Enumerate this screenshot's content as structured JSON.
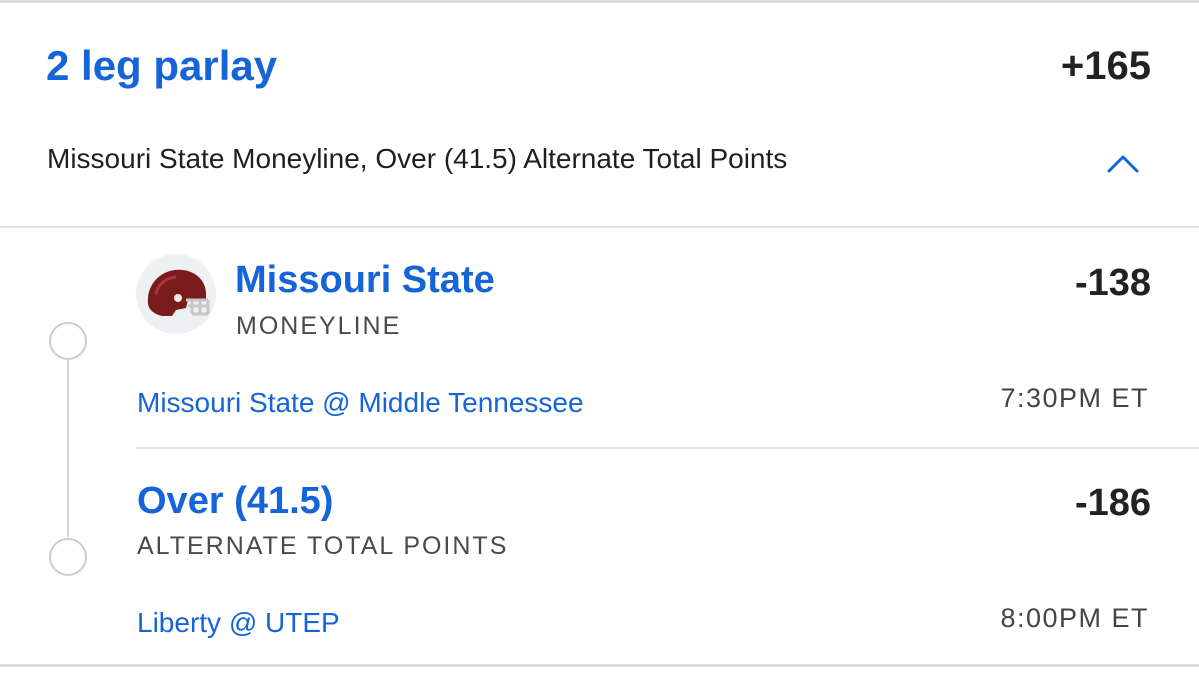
{
  "parlay": {
    "title": "2 leg parlay",
    "odds": "+165",
    "summary": "Missouri State Moneyline, Over (41.5) Alternate Total Points",
    "collapse_icon": "chevron-up-icon"
  },
  "legs": [
    {
      "logo_icon": "football-helmet-icon",
      "logo_color": "#7b1c1c",
      "selection": "Missouri State",
      "market": "MONEYLINE",
      "odds": "-138",
      "matchup": "Missouri State @ Middle Tennessee",
      "time": "7:30PM ET"
    },
    {
      "selection": "Over (41.5)",
      "market": "ALTERNATE TOTAL POINTS",
      "odds": "-186",
      "matchup": "Liberty @ UTEP",
      "time": "8:00PM ET"
    }
  ],
  "colors": {
    "accent": "#1565d8",
    "text": "#222222",
    "divider": "#dde1e6"
  }
}
